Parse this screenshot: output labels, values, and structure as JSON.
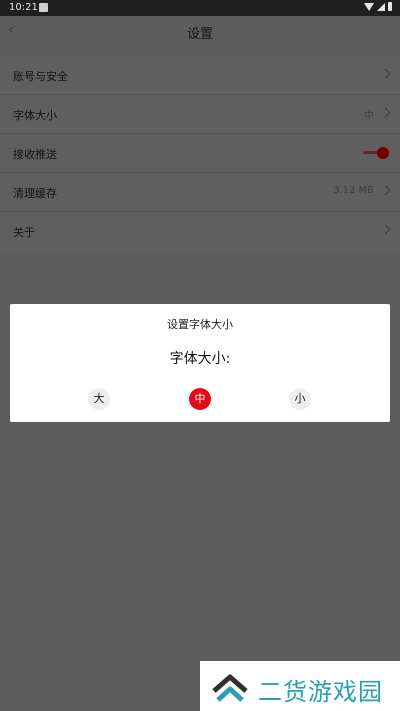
{
  "status_bar": {
    "time": "10:21"
  },
  "header": {
    "title": "设置"
  },
  "settings": {
    "items": [
      {
        "label": "账号与安全",
        "value": ""
      },
      {
        "label": "字体大小",
        "value": "中"
      },
      {
        "label": "接收推送",
        "toggle_on": true
      },
      {
        "label": "清理缓存",
        "value": "3.12 MB"
      },
      {
        "label": "关于",
        "value": ""
      }
    ]
  },
  "dialog": {
    "title": "设置字体大小",
    "label": "字体大小:",
    "options": [
      "大",
      "中",
      "小"
    ],
    "selected": "中"
  },
  "watermark": {
    "text": "二货游戏园"
  },
  "colors": {
    "accent": "#e20b16",
    "overlay": "#5d5d5d",
    "watermark": "#2aa0b4"
  }
}
